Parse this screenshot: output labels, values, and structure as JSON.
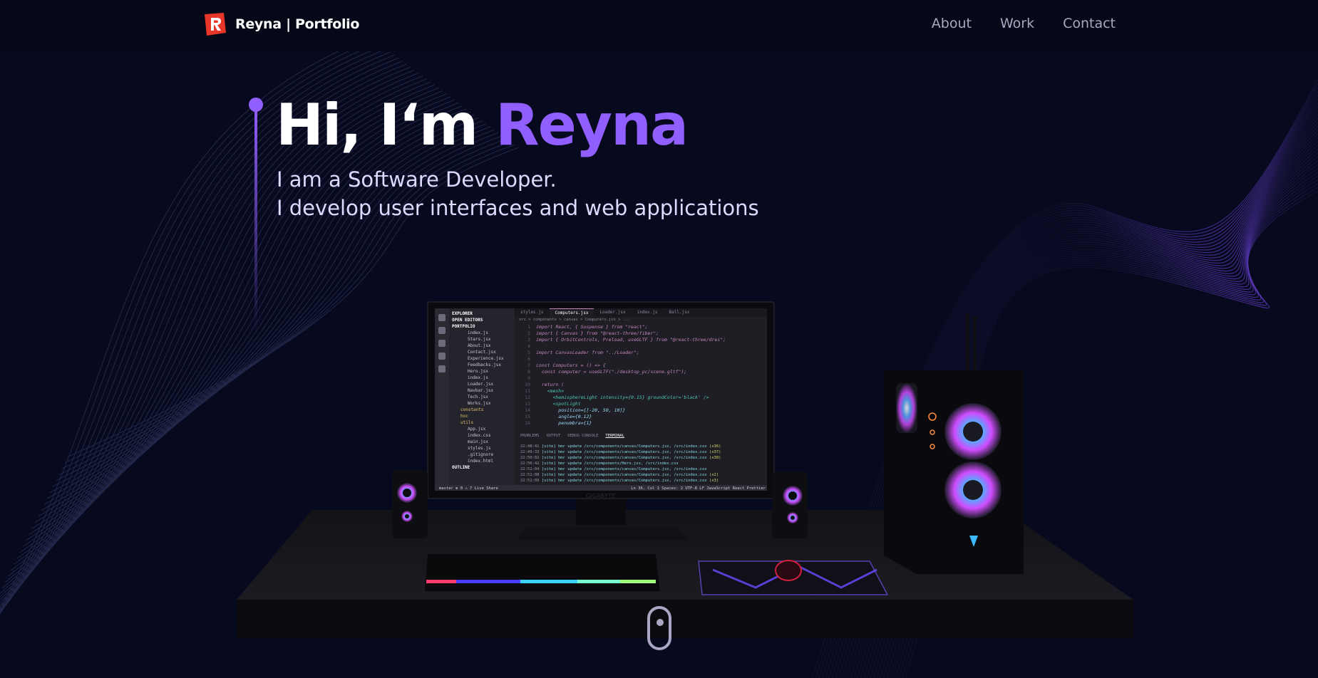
{
  "nav": {
    "logo_icon": "r-logo-icon",
    "brand": "Reyna | Portfolio",
    "links": [
      "About",
      "Work",
      "Contact"
    ]
  },
  "hero": {
    "greeting": "Hi, I‘m ",
    "name": "Reyna",
    "line1": "I am a Software Developer.",
    "line2": "I develop user interfaces and web applications"
  },
  "scene": {
    "monitor_brand": "GIGABYTE",
    "ide": {
      "explorer_title": "EXPLORER",
      "open_editors": "OPEN EDITORS",
      "project": "PORTFOLIO",
      "files": [
        "index.js",
        "Stars.jsx",
        "About.jsx",
        "Contact.jsx",
        "Experience.jsx",
        "Feedbacks.jsx",
        "Hero.jsx",
        "index.js",
        "Loader.jsx",
        "Navbar.jsx",
        "Tech.jsx",
        "Works.jsx"
      ],
      "folders": [
        "constants",
        "hoc",
        "utils"
      ],
      "root_files": [
        "App.jsx",
        "index.css",
        "main.jsx",
        "styles.js",
        ".gitignore",
        "index.html"
      ],
      "outline": "OUTLINE",
      "tabs": [
        "styles.js",
        "Computers.jsx",
        "Loader.jsx",
        "index.js",
        "Ball.jsx"
      ],
      "breadcrumb": "src > components > canvas > Computers.jsx > ...",
      "code": [
        "import React, { Suspense } from \"react\";",
        "import { Canvas } from \"@react-three/fiber\";",
        "import { OrbitControls, Preload, useGLTF } from \"@react-three/drei\";",
        "",
        "import CanvasLoader from \"../Loader\";",
        "",
        "const Computers = () => {",
        "  const computer = useGLTF(\"./desktop_pc/scene.gltf\");",
        "",
        "  return (",
        "    <mesh>",
        "      <hemisphereLight intensity={0.15} groundColor='black' />",
        "      <spotLight",
        "        position={[-20, 50, 10]}",
        "        angle={0.12}",
        "        penumbra={1}"
      ],
      "panel_tabs": [
        "PROBLEMS",
        "OUTPUT",
        "DEBUG CONSOLE",
        "TERMINAL"
      ],
      "terminal": [
        {
          "time": "22:48:41",
          "msg": "[vite] hmr update /src/components/canvas/Computers.jsx, /src/index.css",
          "count": "(x36)"
        },
        {
          "time": "22:49:33",
          "msg": "[vite] hmr update /src/components/canvas/Computers.jsx, /src/index.css",
          "count": "(x37)"
        },
        {
          "time": "22:50:02",
          "msg": "[vite] hmr update /src/components/canvas/Computers.jsx, /src/index.css",
          "count": "(x38)"
        },
        {
          "time": "22:50:42",
          "msg": "[vite] hmr update /src/components/Hero.jsx, /src/index.css",
          "count": ""
        },
        {
          "time": "22:51:04",
          "msg": "[vite] hmr update /src/components/canvas/Computers.jsx, /src/index.css",
          "count": ""
        },
        {
          "time": "22:51:08",
          "msg": "[vite] hmr update /src/components/canvas/Computers.jsx, /src/index.css",
          "count": "(x2)"
        },
        {
          "time": "22:51:09",
          "msg": "[vite] hmr update /src/components/canvas/Computers.jsx, /src/index.css",
          "count": "(x3)"
        }
      ],
      "status_left": "master  ⊗ 0 ⚠ 7   Live Share",
      "status_right": "Ln 36, Col 1   Spaces: 2   UTF-8   LF   JavaScript React   Prettier"
    }
  },
  "scroll_icon": "mouse-scroll-icon",
  "colors": {
    "background": "#050816",
    "accent": "#915eff",
    "secondary_text": "#aaa6c3",
    "hero_text": "#dfd9ff"
  }
}
